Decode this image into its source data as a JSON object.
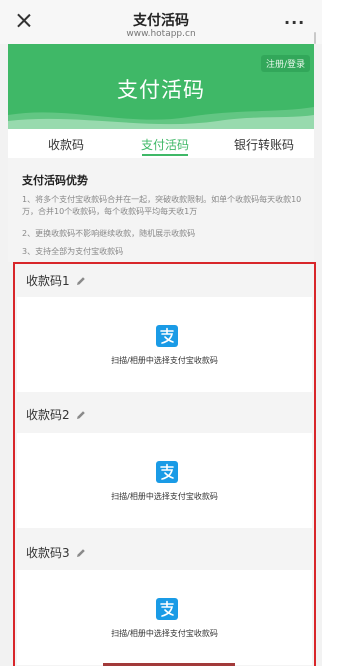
{
  "nav": {
    "title": "支付活码",
    "subtitle": "www.hotapp.cn",
    "more": "···"
  },
  "banner": {
    "title": "支付活码",
    "login_label": "注册/登录"
  },
  "tabs": [
    {
      "label": "收款码",
      "active": false
    },
    {
      "label": "支付活码",
      "active": true
    },
    {
      "label": "银行转账码",
      "active": false
    }
  ],
  "advantages": {
    "title": "支付活码优势",
    "items": [
      "1、将多个支付宝收款码合并在一起，突破收款限制。如单个收款码每天收款10万，合并10个收款码，每个收款码平均每天收1万",
      "2、更换收款码不影响继续收款，随机展示收款码",
      "3、支持全部为支付宝收款码"
    ]
  },
  "qr_codes": [
    {
      "label": "收款码1",
      "hint": "扫描/相册中选择支付宝收款码"
    },
    {
      "label": "收款码2",
      "hint": "扫描/相册中选择支付宝收款码"
    },
    {
      "label": "收款码3",
      "hint": "扫描/相册中选择支付宝收款码"
    }
  ],
  "colors": {
    "brand_green": "#3fb867",
    "alipay_blue": "#1a9be6",
    "highlight_red": "#d8262a"
  },
  "icons": {
    "close": "close-icon",
    "more": "more-icon",
    "edit": "pencil-icon",
    "alipay": "alipay-icon"
  }
}
